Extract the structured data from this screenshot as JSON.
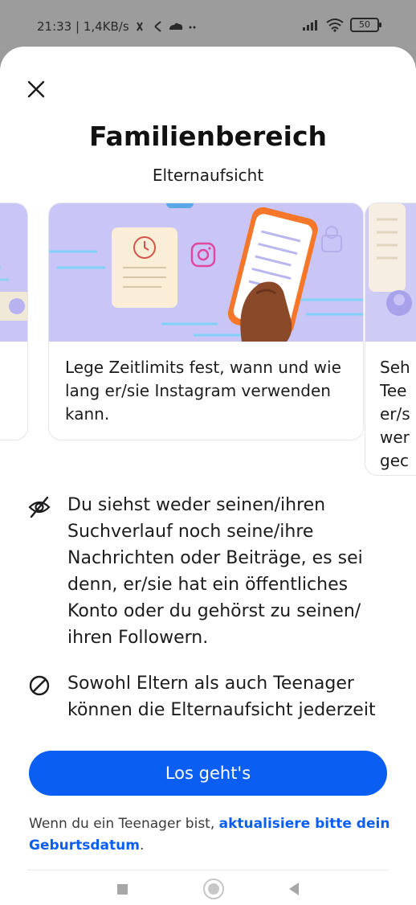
{
  "status_bar": {
    "time_network": "21:33 | 1,4KB/s",
    "battery": "50"
  },
  "header": {
    "title": "Familienbereich",
    "subtitle": "Elternaufsicht"
  },
  "carousel": {
    "cards": [
      {
        "text": ""
      },
      {
        "text": "Lege Zeitlimits fest, wann und wie lang er/sie Instagram verwenden kann."
      },
      {
        "text": "Seh\nTee\ner/s\nwer\ngec"
      }
    ]
  },
  "bullets": [
    {
      "icon": "eye-off-icon",
      "text": "Du siehst weder seinen/ihren Suchverlauf noch seine/ihre Nachrichten oder Beiträge, es sei denn, er/sie hat ein öffentliches Konto oder du gehörst zu seinen/ ihren Followern."
    },
    {
      "icon": "block-icon",
      "text": "Sowohl Eltern als auch Teenager können die Elternaufsicht jederzeit"
    }
  ],
  "cta": {
    "label": "Los geht's"
  },
  "hint": {
    "prefix": "Wenn du ein Teenager bist, ",
    "link": "aktualisiere bitte dein Geburtsdatum",
    "suffix": "."
  },
  "colors": {
    "accent": "#0a5ff2",
    "illustration_bg": "#c9c6f7"
  }
}
